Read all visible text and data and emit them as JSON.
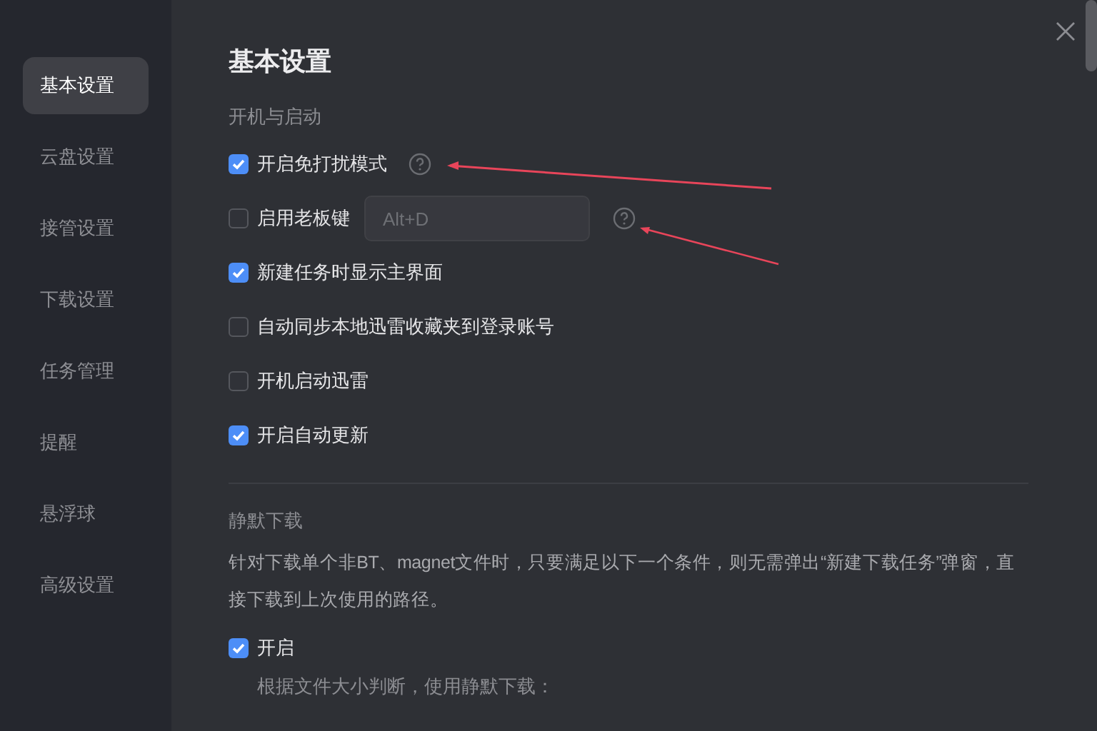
{
  "sidebar": {
    "items": [
      {
        "label": "基本设置",
        "selected": true
      },
      {
        "label": "云盘设置",
        "selected": false
      },
      {
        "label": "接管设置",
        "selected": false
      },
      {
        "label": "下载设置",
        "selected": false
      },
      {
        "label": "任务管理",
        "selected": false
      },
      {
        "label": "提醒",
        "selected": false
      },
      {
        "label": "悬浮球",
        "selected": false
      },
      {
        "label": "高级设置",
        "selected": false
      }
    ]
  },
  "title": "基本设置",
  "sections": [
    {
      "heading": "开机与启动",
      "options": [
        {
          "kind": "help",
          "label": "开启免打扰模式",
          "checked": true
        },
        {
          "kind": "hotkey",
          "label": "启用老板键",
          "checked": false,
          "placeholder": "Alt+D"
        },
        {
          "kind": "plain",
          "label": "新建任务时显示主界面",
          "checked": true
        },
        {
          "kind": "plain",
          "label": "自动同步本地迅雷收藏夹到登录账号",
          "checked": false
        },
        {
          "kind": "plain",
          "label": "开机启动迅雷",
          "checked": false
        },
        {
          "kind": "plain",
          "label": "开启自动更新",
          "checked": true
        }
      ]
    },
    {
      "heading": "静默下载",
      "description": "针对下载单个非BT、magnet文件时，只要满足以下一个条件，则无需弹出“新建下载任务”弹窗，直接下载到上次使用的路径。",
      "options": [
        {
          "kind": "plain",
          "label": "开启",
          "checked": true
        }
      ],
      "note": "根据文件大小判断，使用静默下载："
    }
  ]
}
